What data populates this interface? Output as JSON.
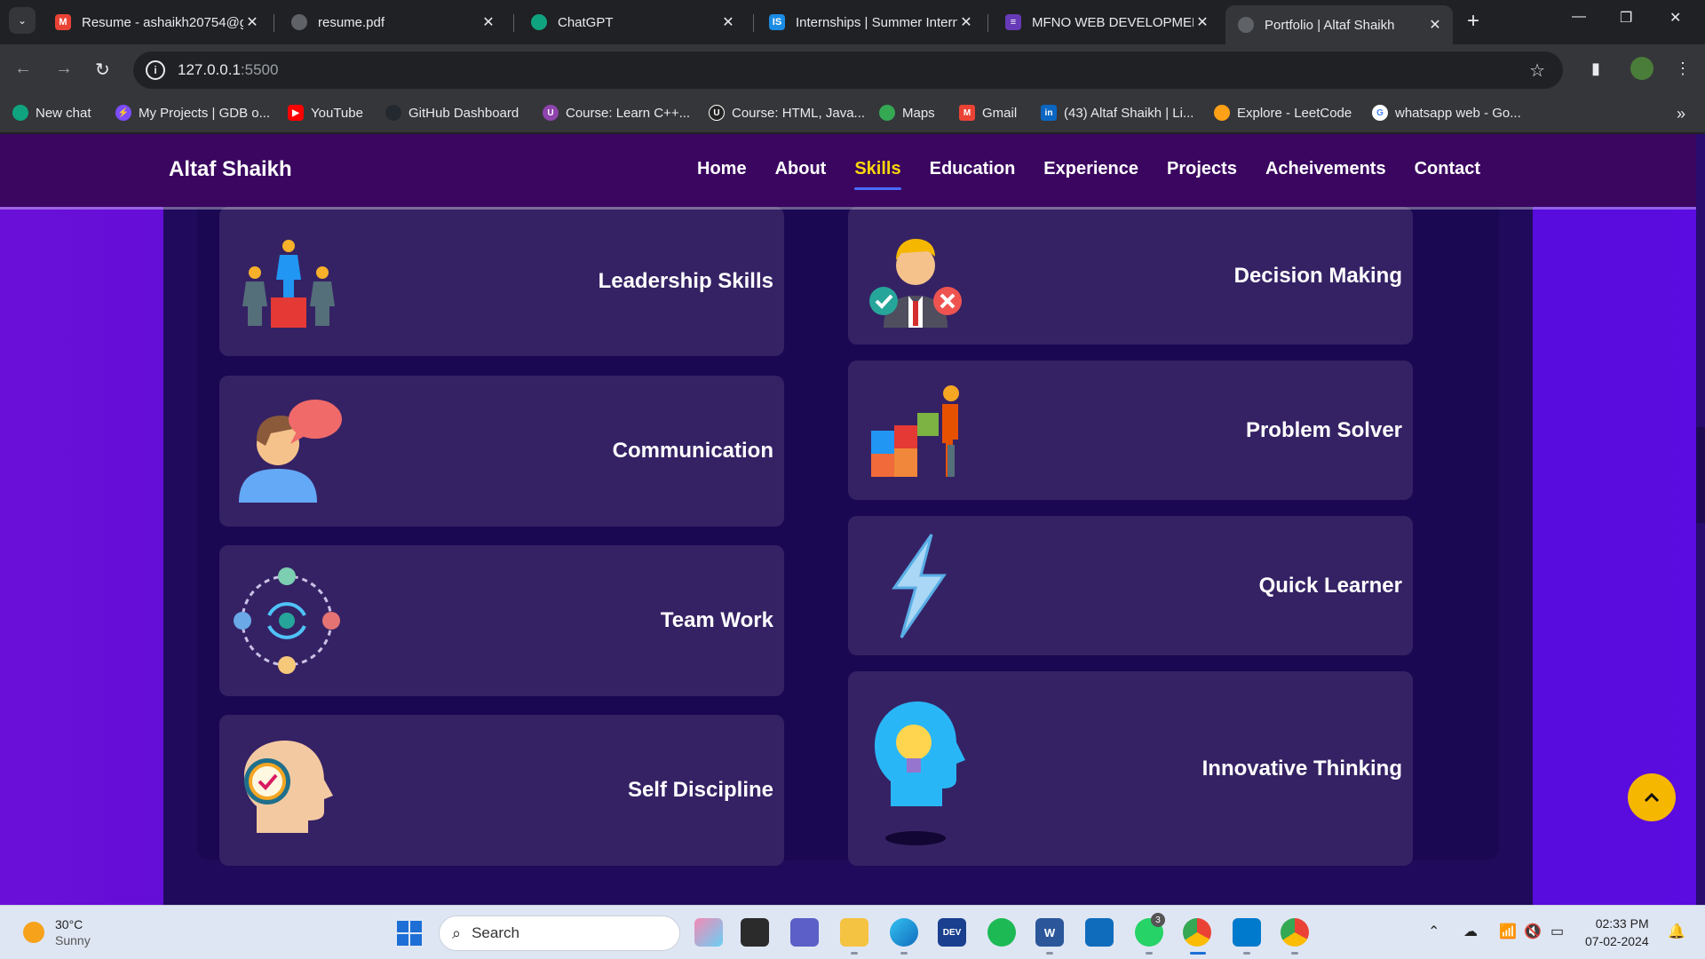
{
  "browser": {
    "tabs": [
      {
        "title": "Resume - ashaikh20754@g",
        "icon": "gmail-icon",
        "color": "#ea4335"
      },
      {
        "title": "resume.pdf",
        "icon": "globe-icon",
        "color": "#5f6368"
      },
      {
        "title": "ChatGPT",
        "icon": "chatgpt-icon",
        "color": "#10a37f"
      },
      {
        "title": "Internships | Summer Intern",
        "icon": "internshala-icon",
        "color": "#1b8ce3"
      },
      {
        "title": "MFNO WEB DEVELOPMEN",
        "icon": "forms-icon",
        "color": "#673ab7"
      },
      {
        "title": "Portfolio | Altaf Shaikh",
        "icon": "globe-icon",
        "color": "#5f6368",
        "active": true
      }
    ],
    "address": {
      "host": "127.0.0.1",
      "port": ":5500"
    },
    "bookmarks": [
      {
        "label": "New chat",
        "icon": "chatgpt-icon",
        "color": "#10a37f"
      },
      {
        "label": "My Projects | GDB o...",
        "icon": "gdb-icon",
        "color": "#7c4dff"
      },
      {
        "label": "YouTube",
        "icon": "youtube-icon",
        "color": "#ff0000"
      },
      {
        "label": "GitHub Dashboard",
        "icon": "github-icon",
        "color": "#24292f"
      },
      {
        "label": "Course: Learn C++...",
        "icon": "course-icon",
        "color": "#8e44ad"
      },
      {
        "label": "Course: HTML, Java...",
        "icon": "course-icon",
        "color": "#222"
      },
      {
        "label": "Maps",
        "icon": "maps-icon",
        "color": "#34a853"
      },
      {
        "label": "Gmail",
        "icon": "gmail-icon",
        "color": "#ea4335"
      },
      {
        "label": "(43) Altaf Shaikh | Li...",
        "icon": "linkedin-icon",
        "color": "#0a66c2"
      },
      {
        "label": "Explore - LeetCode",
        "icon": "leetcode-icon",
        "color": "#ffa116"
      },
      {
        "label": "whatsapp web - Go...",
        "icon": "google-icon",
        "color": "#4285f4"
      }
    ]
  },
  "site": {
    "brand": "Altaf Shaikh",
    "nav": [
      "Home",
      "About",
      "Skills",
      "Education",
      "Experience",
      "Projects",
      "Acheivements",
      "Contact"
    ],
    "active_nav": "Skills",
    "skills_left": [
      {
        "label": "Leadership Skills",
        "icon": "leadership-podium-icon"
      },
      {
        "label": "Communication",
        "icon": "person-speech-bubble-icon"
      },
      {
        "label": "Team Work",
        "icon": "team-network-icon"
      },
      {
        "label": "Self Discipline",
        "icon": "head-clock-gear-icon"
      }
    ],
    "skills_right": [
      {
        "label": "Decision Making",
        "icon": "businessman-check-cross-icon"
      },
      {
        "label": "Problem Solver",
        "icon": "puzzle-person-icon"
      },
      {
        "label": "Quick Learner",
        "icon": "lightning-bolt-icon"
      },
      {
        "label": "Innovative Thinking",
        "icon": "head-lightbulb-icon"
      }
    ],
    "colors": {
      "accent": "#ffd60a",
      "scroll_button": "#f5b700",
      "card": "#352264"
    }
  },
  "taskbar": {
    "weather": {
      "temp": "30°C",
      "condition": "Sunny"
    },
    "search_placeholder": "Search",
    "clock": {
      "time": "02:33 PM",
      "date": "07-02-2024"
    },
    "whatsapp_badge": "3"
  }
}
